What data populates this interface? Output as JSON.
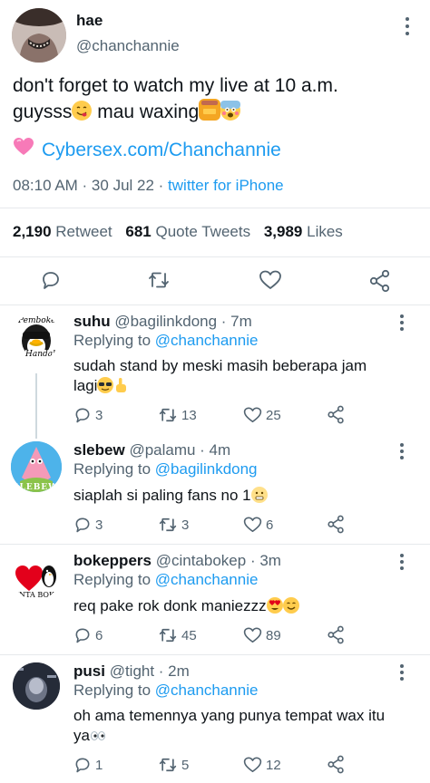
{
  "tweet": {
    "display_name": "hae",
    "handle": "@chanchannie",
    "text_line1": "don't forget to watch my live at 10 a.m.",
    "text_line2": "guysss",
    "text_line2b": "mau waxing",
    "link": "Cybersex.com/Chanchannie",
    "timestamp": "08:10 AM · 30 Jul 22 · ",
    "source": "twitter for iPhone",
    "retweets_count": "2,190",
    "retweets_label": "Retweet",
    "quotes_count": "681",
    "quotes_label": "Quote Tweets",
    "likes_count": "3,989",
    "likes_label": "Likes"
  },
  "replies": [
    {
      "name": "suhu",
      "handle": "@bagilinkdong",
      "time": " · 7m",
      "replying_prefix": "Replying to ",
      "replying_to": "@chanchannie",
      "text_line1": "sudah stand by meski masih beberapa jam",
      "text_line2": "lagi",
      "avatar_text_top": "Pembokep",
      "avatar_text_bottom": "Handal",
      "reply_count": "3",
      "retweet_count": "13",
      "like_count": "25"
    },
    {
      "name": "slebew",
      "handle": "@palamu",
      "time": " · 4m",
      "replying_prefix": "Replying to ",
      "replying_to": "@bagilinkdong",
      "text_line1": "siaplah si paling fans no 1",
      "avatar_text": "SLEBEW",
      "reply_count": "3",
      "retweet_count": "3",
      "like_count": "6"
    },
    {
      "name": "bokeppers",
      "handle": "@cintabokep",
      "time": " · 3m",
      "replying_prefix": "Replying to ",
      "replying_to": "@chanchannie",
      "text_line1": "req pake rok donk maniezzz",
      "avatar_text": "INTA BOKE",
      "reply_count": "6",
      "retweet_count": "45",
      "like_count": "89"
    },
    {
      "name": "pusi",
      "handle": "@tight",
      "time": " · 2m",
      "replying_prefix": "Replying to ",
      "replying_to": "@chanchannie",
      "text_line1": "oh ama temennya yang punya tempat wax itu",
      "text_line2": "ya",
      "reply_count": "1",
      "retweet_count": "5",
      "like_count": "12"
    }
  ],
  "colors": {
    "accent": "#1d9bf0",
    "text": "#0f1419",
    "muted": "#536471",
    "divider": "#e6e9ec"
  },
  "icons": [
    "more-vertical-icon",
    "pink-heart-emoji",
    "reply-icon",
    "retweet-icon",
    "like-icon",
    "share-icon"
  ]
}
